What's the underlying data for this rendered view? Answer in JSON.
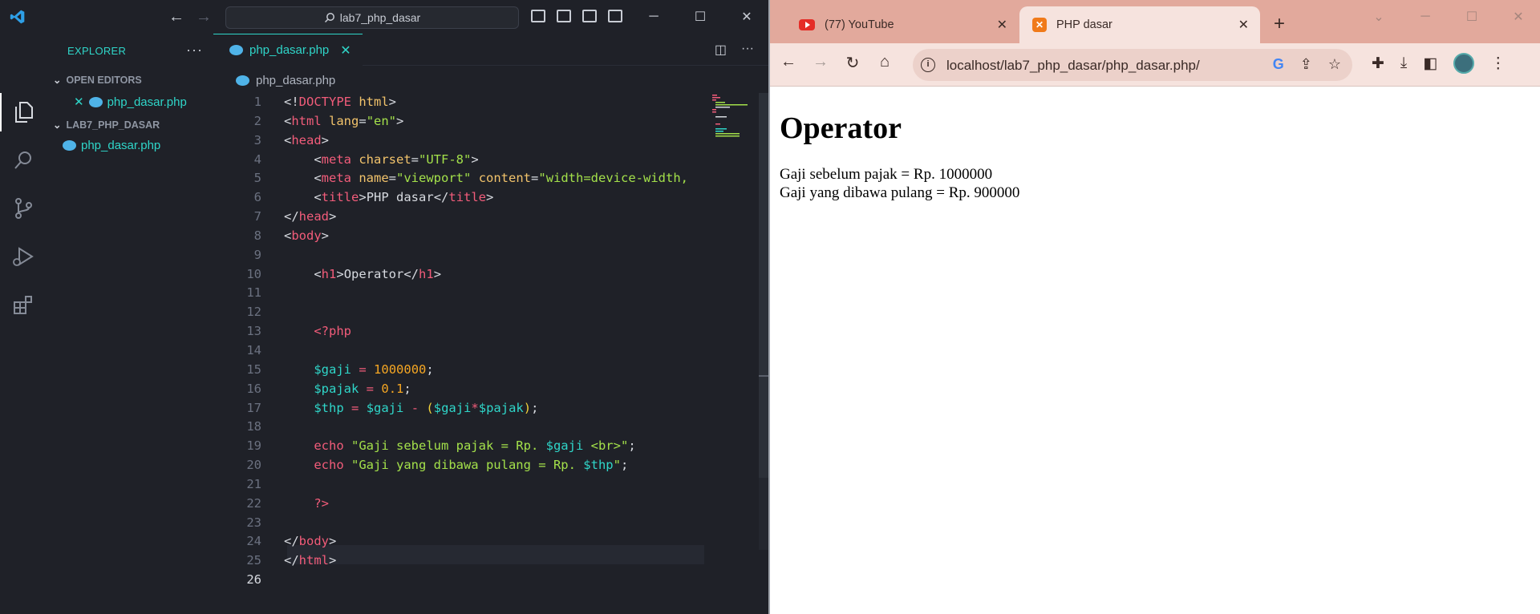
{
  "vscode": {
    "search_text": "lab7_php_dasar",
    "explorer_title": "EXPLORER",
    "open_editors_label": "OPEN EDITORS",
    "open_editor_file": "php_dasar.php",
    "project_label": "LAB7_PHP_DASAR",
    "project_file": "php_dasar.php",
    "tab_label": "php_dasar.php",
    "breadcrumb": "php_dasar.php",
    "current_line": 26
  },
  "chrome": {
    "tabs": [
      {
        "label": "(77) YouTube",
        "active": false
      },
      {
        "label": "PHP dasar",
        "active": true
      }
    ],
    "url": "localhost/lab7_php_dasar/php_dasar.php/"
  },
  "page": {
    "heading": "Operator",
    "lines": [
      "Gaji sebelum pajak = Rp. 1000000",
      "Gaji yang dibawa pulang = Rp. 900000"
    ]
  }
}
